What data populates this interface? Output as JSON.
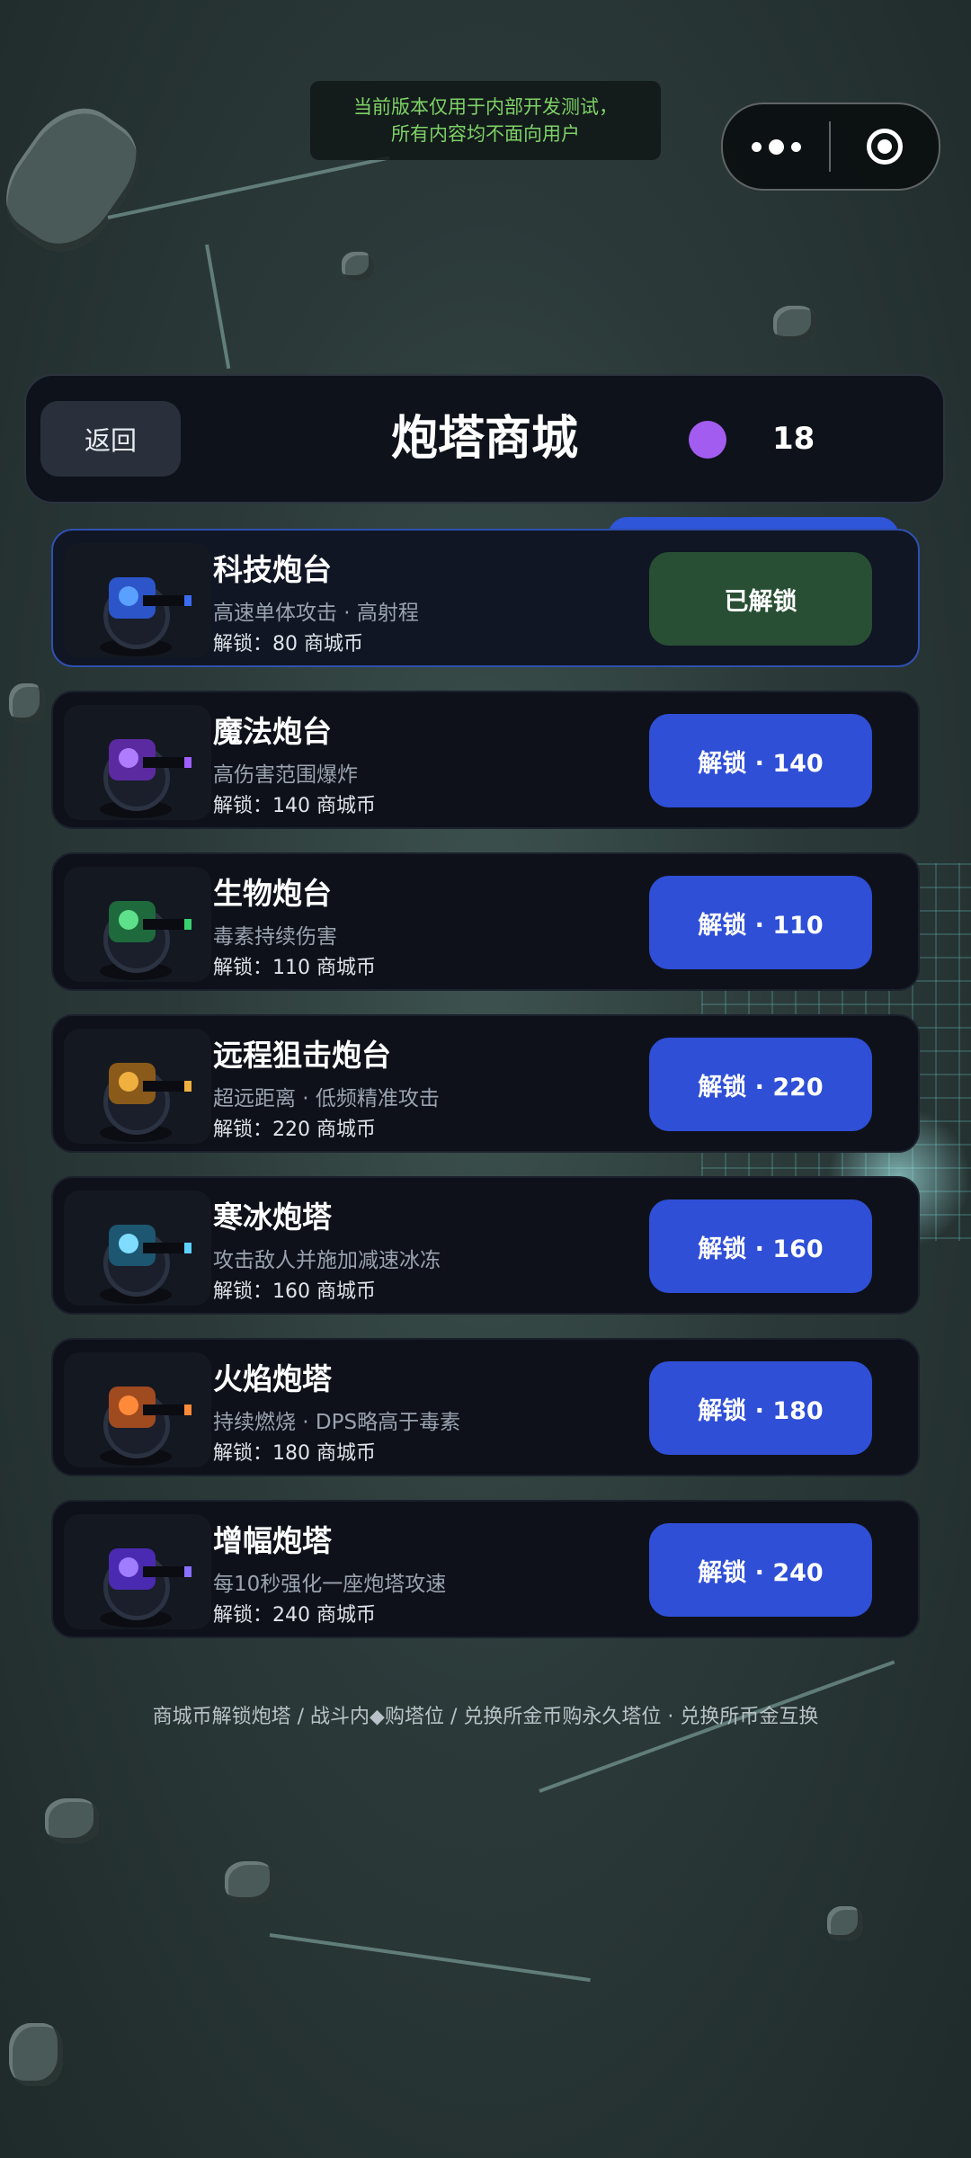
{
  "notice": {
    "line1": "当前版本仅用于内部开发测试，",
    "line2": "所有内容均不面向用户"
  },
  "capsule": {
    "more_icon": "more-dots-icon",
    "close_icon": "target-circle-icon"
  },
  "header": {
    "back_label": "返回",
    "title": "炮塔商城",
    "coin_icon": "purple-coin-icon",
    "coin_count": "18"
  },
  "colors": {
    "accent_blue": "#2f4fd6",
    "unlocked_green": "#284f34",
    "coin_purple": "#a35cf0",
    "notice_green": "#7ed266"
  },
  "towers": [
    {
      "name": "科技炮台",
      "desc": "高速单体攻击 · 高射程",
      "cost": "解锁：80 商城币",
      "button": "已解锁",
      "unlocked": true,
      "color": "#2b55c8",
      "core": "#5aa0ff",
      "tip": "#3a6cf0"
    },
    {
      "name": "魔法炮台",
      "desc": "高伤害范围爆炸",
      "cost": "解锁：140 商城币",
      "button": "解锁 · 140",
      "unlocked": false,
      "color": "#5b2aa0",
      "core": "#b07cff",
      "tip": "#a060ff"
    },
    {
      "name": "生物炮台",
      "desc": "毒素持续伤害",
      "cost": "解锁：110 商城币",
      "button": "解锁 · 110",
      "unlocked": false,
      "color": "#1e6a3c",
      "core": "#5fe08a",
      "tip": "#3ad070"
    },
    {
      "name": "远程狙击炮台",
      "desc": "超远距离 · 低频精准攻击",
      "cost": "解锁：220 商城币",
      "button": "解锁 · 220",
      "unlocked": false,
      "color": "#8a5a1a",
      "core": "#f0b040",
      "tip": "#f0b040"
    },
    {
      "name": "寒冰炮塔",
      "desc": "攻击敌人并施加减速冰冻",
      "cost": "解锁：160 商城币",
      "button": "解锁 · 160",
      "unlocked": false,
      "color": "#1d5670",
      "core": "#7fdcff",
      "tip": "#5fd0ff"
    },
    {
      "name": "火焰炮塔",
      "desc": "持续燃烧 · DPS略高于毒素",
      "cost": "解锁：180 商城币",
      "button": "解锁 · 180",
      "unlocked": false,
      "color": "#a04a20",
      "core": "#ff8a3a",
      "tip": "#ff8a3a"
    },
    {
      "name": "增幅炮塔",
      "desc": "每10秒强化一座炮塔攻速",
      "cost": "解锁：240 商城币",
      "button": "解锁 · 240",
      "unlocked": false,
      "color": "#4a2ab0",
      "core": "#a07cff",
      "tip": "#8a70ff"
    }
  ],
  "footer": "商城币解锁炮塔 / 战斗内◆购塔位 / 兑换所金币购永久塔位 · 兑换所币金互换"
}
